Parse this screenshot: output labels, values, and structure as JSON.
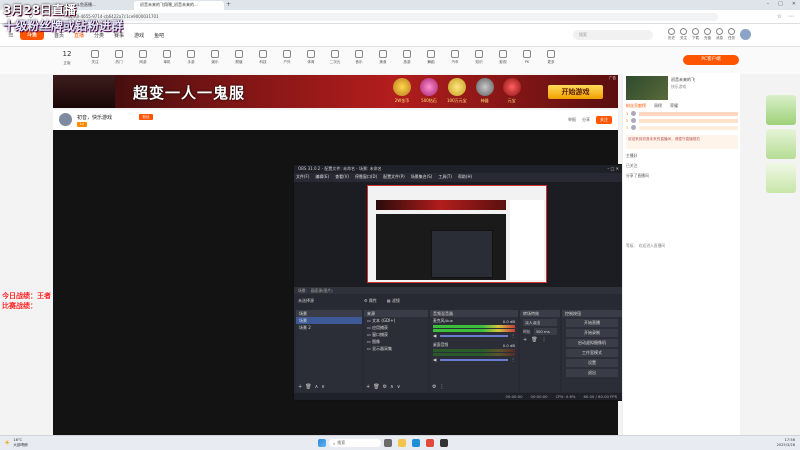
{
  "overlay": {
    "title_line1": "3月28日直播",
    "title_line2": "十级粉丝牌或钻粉进群",
    "stats_line1": "今日战绩：王者",
    "stats_line2": "比赛战绩："
  },
  "browser": {
    "tabs": [
      "斗鱼直播...",
      "初音未来的飞翔嘿_初音未来的..."
    ],
    "url": "...0243I-4655-9714-cb6422a7c1ce9000031701"
  },
  "site": {
    "logo": "斗鱼",
    "nav": [
      "首页",
      "直播",
      "分类",
      "赛事",
      "游戏",
      "鱼吧"
    ],
    "search_placeholder": "搜索",
    "user_items": [
      "历史",
      "关注",
      "下载",
      "充值",
      "消息",
      "任务"
    ],
    "categories": [
      {
        "count": "12",
        "label": "正版"
      },
      {
        "label": "关注"
      },
      {
        "label": "热门"
      },
      {
        "label": "网游"
      },
      {
        "label": "单机"
      },
      {
        "label": "手游"
      },
      {
        "label": "娱乐"
      },
      {
        "label": "颜值"
      },
      {
        "label": "科技"
      },
      {
        "label": "户外"
      },
      {
        "label": "体育"
      },
      {
        "label": "二次元"
      },
      {
        "label": "音乐"
      },
      {
        "label": "美食"
      },
      {
        "label": "旅游"
      },
      {
        "label": "舞蹈"
      },
      {
        "label": "汽车"
      },
      {
        "label": "知识"
      },
      {
        "label": "影视"
      },
      {
        "label": "PK"
      },
      {
        "label": "更多"
      }
    ],
    "pc_link": "PC客户端"
  },
  "banner": {
    "headline": "超变一人一鬼服",
    "items": [
      "2W金币",
      "500钻石",
      "100万元宝",
      "神器",
      "元宝"
    ],
    "cta": "开始游戏",
    "ad": "广告"
  },
  "room": {
    "title": "初音，快乐游戏",
    "level": "Lv",
    "report": "举报",
    "follow": "关注",
    "share": "分享",
    "fans": "粉丝"
  },
  "obs": {
    "title": "OBS 31.0.2 - 配置文件: 未命名 - 场景: 未命名",
    "menu": [
      "文件(F)",
      "编辑(E)",
      "查看(V)",
      "停靠窗口(D)",
      "配置文件(P)",
      "场景集合(S)",
      "工具(T)",
      "帮助(H)"
    ],
    "status_left": "场景：  画面源(图片)",
    "no_source": "未选择源",
    "props_button": "属性",
    "filters_button": "滤镜",
    "panels": {
      "scenes": "场景",
      "sources": "来源",
      "mixer": "音频混音器",
      "transitions": "转场特效",
      "controls": "控制按钮"
    },
    "scenes": [
      "场景",
      "场景 2"
    ],
    "sources": [
      "文本 (GDI+)",
      "应用捕获",
      "窗口捕获",
      "图像",
      "显示器采集"
    ],
    "mixer": [
      {
        "name": "桌面音频",
        "level": "0.0 dB"
      },
      {
        "name": "麦克风/Aux",
        "level": "0.0 dB"
      }
    ],
    "transition": "淡入淡出",
    "duration_label": "时长",
    "duration": "300 ms",
    "controls": [
      "开始直播",
      "开始录制",
      "启动虚拟摄像机",
      "工作室模式",
      "设置",
      "退出"
    ],
    "status_bar": [
      "00:00:00",
      "00:00:00",
      "CPU: 0.6%",
      "60.00 / 60.00 FPS"
    ]
  },
  "right": {
    "streamer": "初音未来的飞",
    "subtitle": "快乐游戏",
    "tabs": [
      "粉丝贡献榜",
      "周榜",
      "荣耀"
    ],
    "ranks": [
      "1",
      "2",
      "3"
    ],
    "notice": "欢迎来到初音未来的直播间，请遵守直播规范",
    "chat": [
      "主播好",
      "已关注",
      "分享了直播间"
    ],
    "footer": "等级：   欢迎进入直播间"
  },
  "taskbar": {
    "weather_temp": "18°C",
    "weather_desc": "大部晴朗",
    "search": "搜索",
    "time": "17:56",
    "date": "2025/3/28"
  },
  "colors": {
    "accent": "#ff5500",
    "overlay_title": "#ffffff",
    "overlay_subtitle": "#e8e8ff",
    "overlay_stats": "#ff1e1e",
    "obs_bg": "#272a33"
  }
}
